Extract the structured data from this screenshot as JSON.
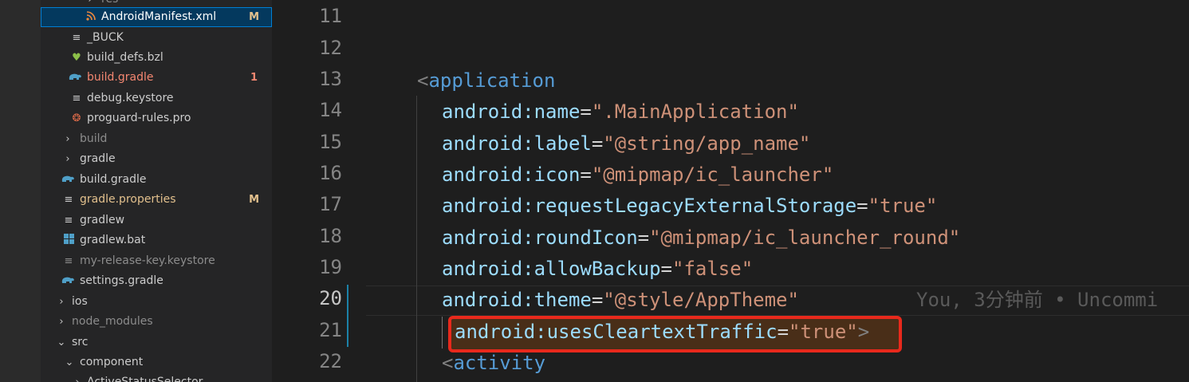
{
  "explorer": {
    "items": [
      {
        "label": "res",
        "icon": "chevron-right-icon",
        "badge": "",
        "state": "dim"
      },
      {
        "label": "AndroidManifest.xml",
        "icon": "rss-icon",
        "badge": "M",
        "state": "selected"
      },
      {
        "label": "_BUCK",
        "icon": "lines-icon",
        "badge": "",
        "state": "normal"
      },
      {
        "label": "build_defs.bzl",
        "icon": "heart-icon",
        "badge": "",
        "state": "normal"
      },
      {
        "label": "build.gradle",
        "icon": "elephant-icon",
        "badge": "1",
        "state": "error"
      },
      {
        "label": "debug.keystore",
        "icon": "lines-icon",
        "badge": "",
        "state": "normal"
      },
      {
        "label": "proguard-rules.pro",
        "icon": "bug-icon",
        "badge": "",
        "state": "normal"
      },
      {
        "label": "build",
        "icon": "chevron-right-icon",
        "badge": "",
        "state": "dim"
      },
      {
        "label": "gradle",
        "icon": "chevron-right-icon",
        "badge": "",
        "state": "normal"
      },
      {
        "label": "build.gradle",
        "icon": "elephant-icon",
        "badge": "",
        "state": "normal"
      },
      {
        "label": "gradle.properties",
        "icon": "lines-icon",
        "badge": "M",
        "state": "modified"
      },
      {
        "label": "gradlew",
        "icon": "lines-icon",
        "badge": "",
        "state": "normal"
      },
      {
        "label": "gradlew.bat",
        "icon": "windows-icon",
        "badge": "",
        "state": "normal"
      },
      {
        "label": "my-release-key.keystore",
        "icon": "lines-icon",
        "badge": "",
        "state": "dim"
      },
      {
        "label": "settings.gradle",
        "icon": "elephant-icon",
        "badge": "",
        "state": "normal"
      },
      {
        "label": "ios",
        "icon": "chevron-right-icon",
        "badge": "",
        "state": "normal"
      },
      {
        "label": "node_modules",
        "icon": "chevron-right-icon",
        "badge": "",
        "state": "dim"
      },
      {
        "label": "src",
        "icon": "chevron-down-icon",
        "badge": "",
        "state": "normal"
      },
      {
        "label": "component",
        "icon": "chevron-down-icon",
        "badge": "",
        "state": "normal"
      },
      {
        "label": "ActiveStatusSelector",
        "icon": "chevron-right-icon",
        "badge": "",
        "state": "normal"
      }
    ]
  },
  "editor": {
    "line_numbers": [
      "11",
      "12",
      "13",
      "14",
      "15",
      "16",
      "17",
      "18",
      "19",
      "20",
      "21",
      "22"
    ],
    "current_line": "20",
    "lines": {
      "l13": {
        "open": "<",
        "tag": "application"
      },
      "l14": {
        "attr": "android:name",
        "eq": "=",
        "val": "\".MainApplication\""
      },
      "l15": {
        "attr": "android:label",
        "eq": "=",
        "val": "\"@string/app_name\""
      },
      "l16": {
        "attr": "android:icon",
        "eq": "=",
        "val": "\"@mipmap/ic_launcher\""
      },
      "l17": {
        "attr": "android:requestLegacyExternalStorage",
        "eq": "=",
        "val": "\"true\""
      },
      "l18": {
        "attr": "android:roundIcon",
        "eq": "=",
        "val": "\"@mipmap/ic_launcher_round\""
      },
      "l19": {
        "attr": "android:allowBackup",
        "eq": "=",
        "val": "\"false\""
      },
      "l20": {
        "attr": "android:theme",
        "eq": "=",
        "val": "\"@style/AppTheme\""
      },
      "l21": {
        "attr": "android:usesCleartextTraffic",
        "eq": "=",
        "val": "\"true\"",
        "close": ">"
      },
      "l22": {
        "open": "<",
        "tag": "activity"
      }
    },
    "blame": "You, 3分钟前 • Uncommi"
  },
  "colors": {
    "tag": "#569cd6",
    "attribute": "#9cdcfe",
    "string": "#ce9178",
    "highlight_border": "#e8291c",
    "selection": "#04395e"
  }
}
